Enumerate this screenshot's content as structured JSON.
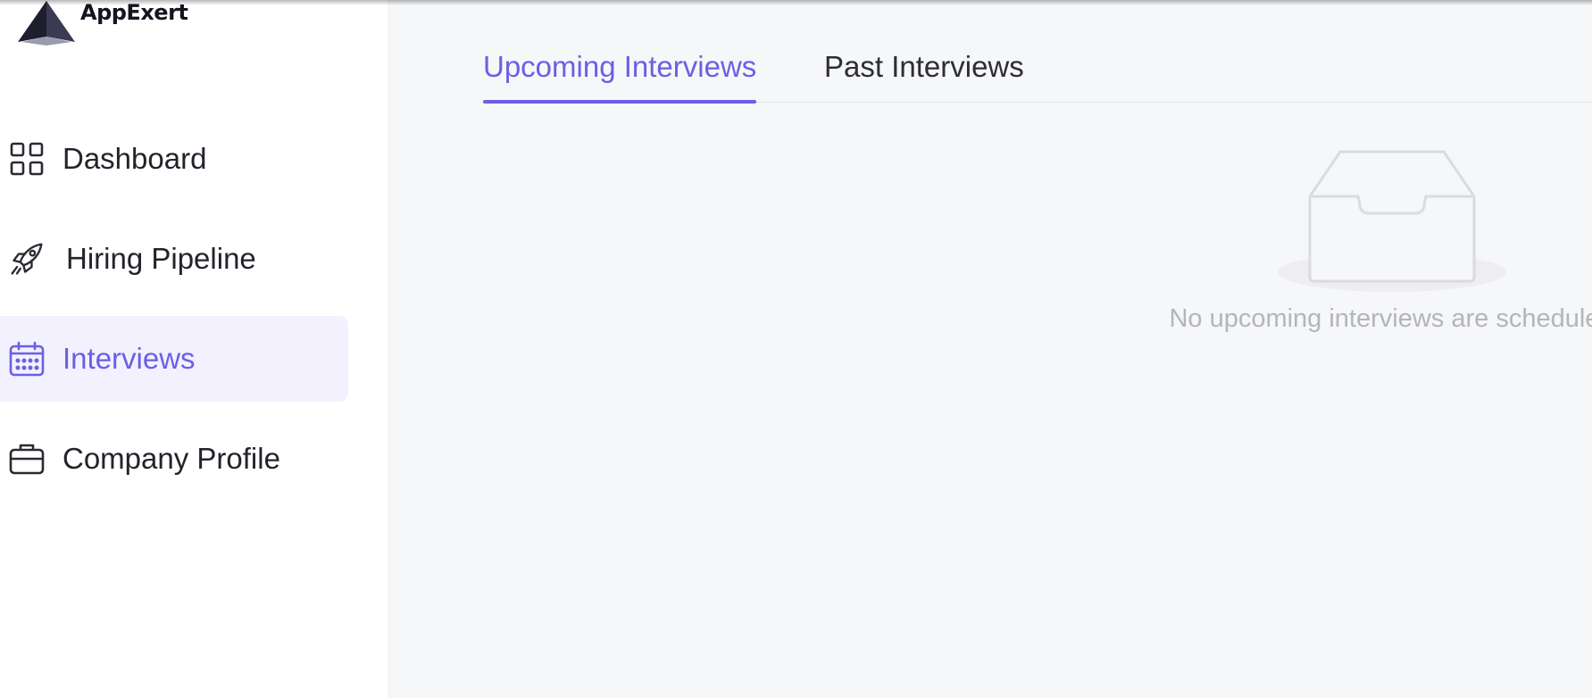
{
  "app": {
    "brand": "AppExert"
  },
  "sidebar": {
    "items": [
      {
        "label": "Dashboard",
        "icon": "grid-icon",
        "active": false
      },
      {
        "label": "Hiring Pipeline",
        "icon": "rocket-icon",
        "active": false
      },
      {
        "label": "Interviews",
        "icon": "calendar-icon",
        "active": true
      },
      {
        "label": "Company Profile",
        "icon": "briefcase-icon",
        "active": false
      }
    ]
  },
  "tabs": [
    {
      "label": "Upcoming Interviews",
      "active": true
    },
    {
      "label": "Past Interviews",
      "active": false
    }
  ],
  "empty_state": {
    "icon": "inbox-icon",
    "message": "No upcoming interviews are scheduled"
  },
  "colors": {
    "accent": "#6b5fe5",
    "active_bg": "#f3f1fd",
    "main_bg": "#f6f7f9",
    "text": "#23232b",
    "muted": "#b4b4bb"
  }
}
